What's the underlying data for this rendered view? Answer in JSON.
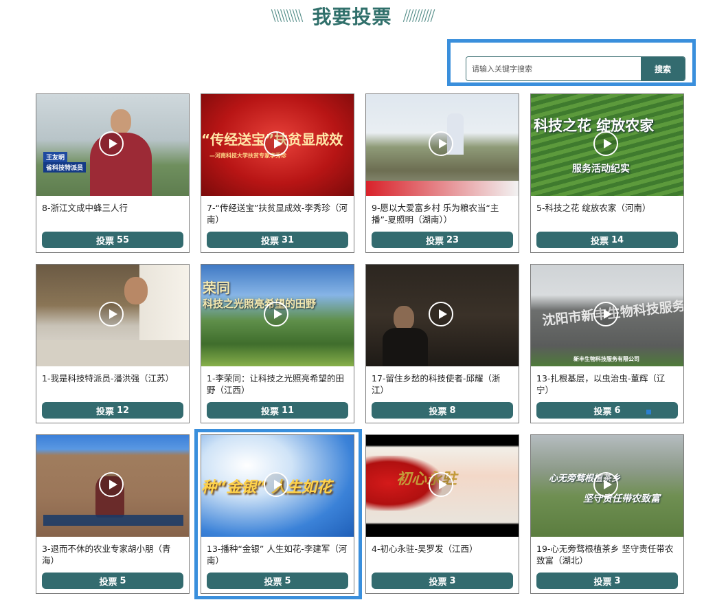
{
  "header": {
    "title": "我要投票",
    "left_deco": "\\\\\\\\\\\\\\\\\\\\",
    "right_deco": "//////////"
  },
  "search": {
    "placeholder": "请输入关键字搜索",
    "button": "搜索"
  },
  "cards": [
    {
      "title": "8-浙江文成中蜂三人行",
      "vote_label": "投票",
      "votes": "55",
      "overlay": [
        "王友明",
        "省科技特派员"
      ]
    },
    {
      "title": "7-“传经送宝”扶贫显成效-李秀珍（河南）",
      "vote_label": "投票",
      "votes": "31",
      "overlay": [
        "“传经送宝”扶贫显成效",
        "—河南科技大学扶贫专家李秀珍"
      ]
    },
    {
      "title": "9-愿以大爱富乡村 乐为粮农当“主播”-夏照明（湖南））",
      "vote_label": "投票",
      "votes": "23",
      "overlay": []
    },
    {
      "title": "5-科技之花 绽放农家（河南）",
      "vote_label": "投票",
      "votes": "14",
      "overlay": [
        "科技之花 绽放农家",
        "服务活动纪实"
      ]
    },
    {
      "title": "1-我是科技特派员-潘洪强（江苏）",
      "vote_label": "投票",
      "votes": "12",
      "overlay": []
    },
    {
      "title": "1-李荣同：让科技之光照亮希望的田野（江西）",
      "vote_label": "投票",
      "votes": "11",
      "overlay": [
        "荣同",
        "科技之光照亮希望的田野"
      ]
    },
    {
      "title": "17-留住乡愁的科技使者-邱耀（浙江）",
      "vote_label": "投票",
      "votes": "8",
      "overlay": []
    },
    {
      "title": "13-扎根基层，以虫治虫-董辉（辽宁）",
      "vote_label": "投票",
      "votes": "6",
      "overlay": [
        "沈阳市新丰生物科技服务",
        "新丰生物科技服务有限公司"
      ]
    },
    {
      "title": "3-退而不休的农业专家胡小朋（青海）",
      "vote_label": "投票",
      "votes": "5",
      "overlay": []
    },
    {
      "title": "13-播种“金银” 人生如花-李建军（河南）",
      "vote_label": "投票",
      "votes": "5",
      "overlay": [
        "种“金银” 人生如花"
      ]
    },
    {
      "title": "4-初心永驻-吴罗发（江西）",
      "vote_label": "投票",
      "votes": "3",
      "overlay": [
        "初心永驻"
      ]
    },
    {
      "title": "19-心无旁骛根植茶乡 坚守责任带农致富（湖北）",
      "vote_label": "投票",
      "votes": "3",
      "overlay": [
        "心无旁骛根植茶乡",
        "坚守责任带农致富"
      ]
    }
  ],
  "colors": {
    "accent": "#336b6f",
    "highlight": "#3a8fdc",
    "title": "#2f6f6a"
  },
  "icons": [
    "play-icon"
  ]
}
